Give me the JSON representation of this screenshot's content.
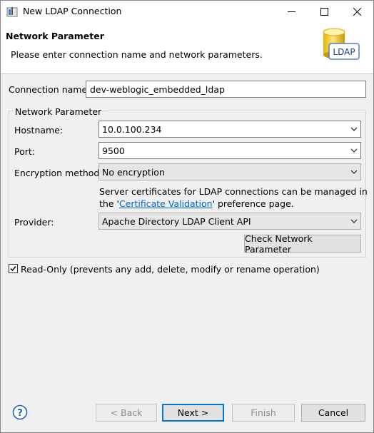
{
  "window": {
    "title": "New LDAP Connection"
  },
  "banner": {
    "title": "Network Parameter",
    "description": "Please enter connection name and network parameters.",
    "icon_label": "LDAP",
    "icon": "ldap-database-icon"
  },
  "form": {
    "connection_name_label": "Connection name:",
    "connection_name_value": "dev-weblogic_embedded_ldap",
    "group_title": "Network Parameter",
    "hostname_label": "Hostname:",
    "hostname_value": "10.0.100.234",
    "port_label": "Port:",
    "port_value": "9500",
    "encryption_label": "Encryption method:",
    "encryption_value": "No encryption",
    "cert_note_line1": "Server certificates for LDAP connections can be managed in",
    "cert_note_prefix": "the '",
    "cert_note_link": "Certificate Validation",
    "cert_note_suffix": "' preference page.",
    "provider_label": "Provider:",
    "provider_value": "Apache Directory LDAP Client API",
    "check_button": "Check Network Parameter",
    "readonly_label": "Read-Only (prevents any add, delete, modify or rename operation)",
    "readonly_checked": true
  },
  "footer": {
    "help_icon": "help-icon",
    "back": "< Back",
    "next": "Next >",
    "finish": "Finish",
    "cancel": "Cancel"
  },
  "colors": {
    "link": "#0066cc",
    "default_button_border": "#0078d7"
  }
}
